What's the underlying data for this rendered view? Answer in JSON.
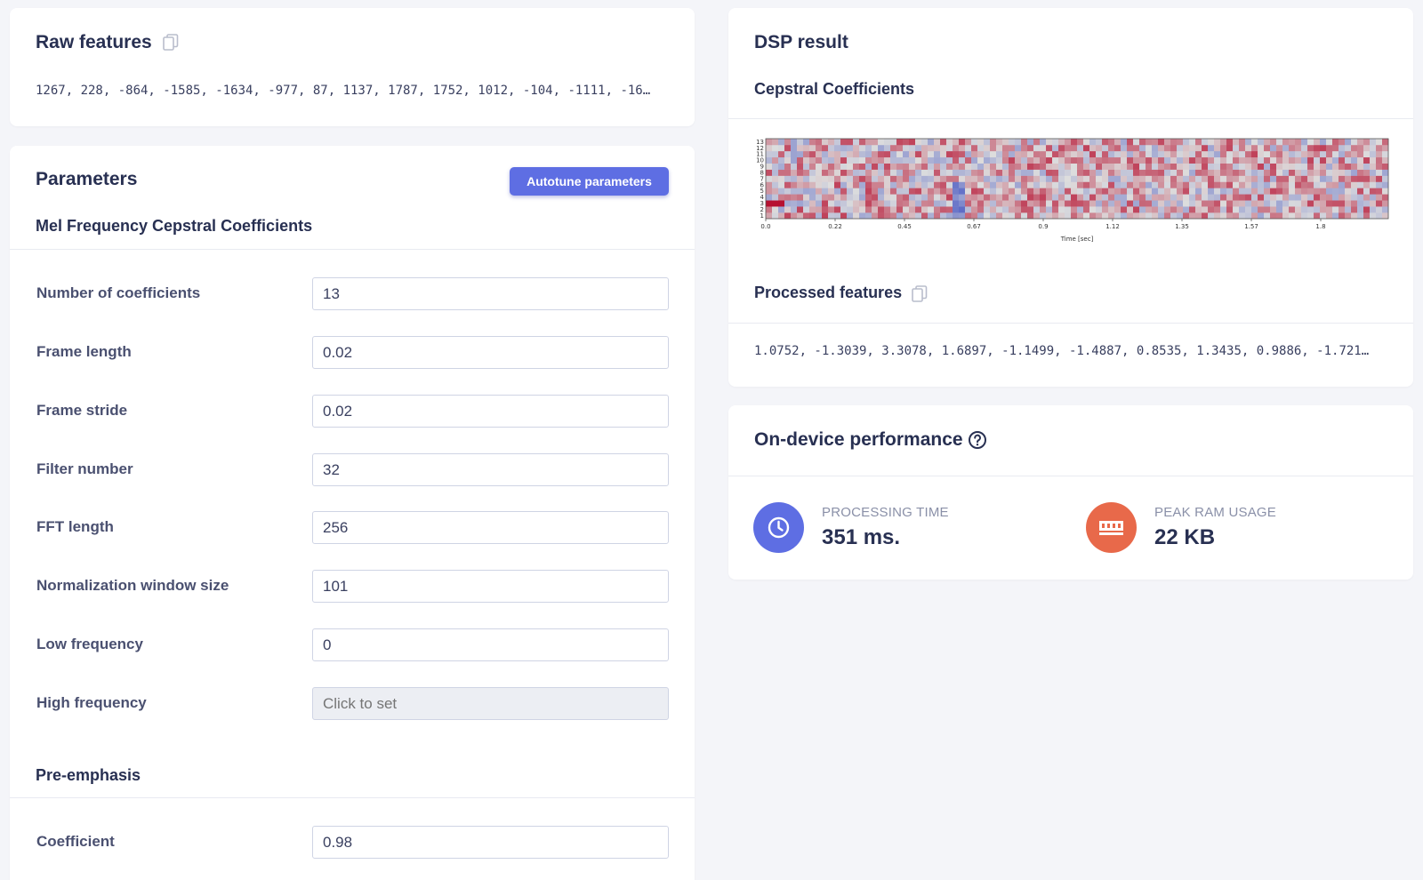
{
  "raw_features": {
    "title": "Raw features",
    "values": "1267, 228, -864, -1585, -1634, -977, 87, 1137, 1787, 1752, 1012, -104, -1111, -16…"
  },
  "parameters": {
    "title": "Parameters",
    "autotune_label": "Autotune parameters",
    "mfcc_section": "Mel Frequency Cepstral Coefficients",
    "fields": [
      {
        "label": "Number of coefficients",
        "value": "13"
      },
      {
        "label": "Frame length",
        "value": "0.02"
      },
      {
        "label": "Frame stride",
        "value": "0.02"
      },
      {
        "label": "Filter number",
        "value": "32"
      },
      {
        "label": "FFT length",
        "value": "256"
      },
      {
        "label": "Normalization window size",
        "value": "101"
      },
      {
        "label": "Low frequency",
        "value": "0"
      }
    ],
    "high_frequency": {
      "label": "High frequency",
      "placeholder": "Click to set"
    },
    "preemphasis_section": "Pre-emphasis",
    "coefficient": {
      "label": "Coefficient",
      "value": "0.98"
    }
  },
  "dsp_result": {
    "title": "DSP result",
    "cepstral_title": "Cepstral Coefficients",
    "processed_title": "Processed features",
    "processed_values": "1.0752, -1.3039, 3.3078, 1.6897, -1.1499, -1.4887, 0.8535, 1.3435, 0.9886, -1.721…"
  },
  "chart_data": {
    "type": "heatmap",
    "xlabel": "Time [sec]",
    "ylabel": "",
    "x_ticks": [
      "0.0",
      "0.22",
      "0.45",
      "0.67",
      "0.9",
      "1.12",
      "1.35",
      "1.57",
      "1.8"
    ],
    "y_ticks": [
      "1",
      "2",
      "3",
      "4",
      "5",
      "6",
      "7",
      "8",
      "9",
      "10",
      "11",
      "12",
      "13"
    ],
    "colors": {
      "low": "#3b4cc0",
      "mid": "#dddddd",
      "high": "#b40426"
    }
  },
  "performance": {
    "title": "On-device performance",
    "processing_label": "PROCESSING TIME",
    "processing_value": "351 ms.",
    "ram_label": "PEAK RAM USAGE",
    "ram_value": "22 KB",
    "colors": {
      "processing": "#5e6ee3",
      "ram": "#e8694a"
    }
  }
}
